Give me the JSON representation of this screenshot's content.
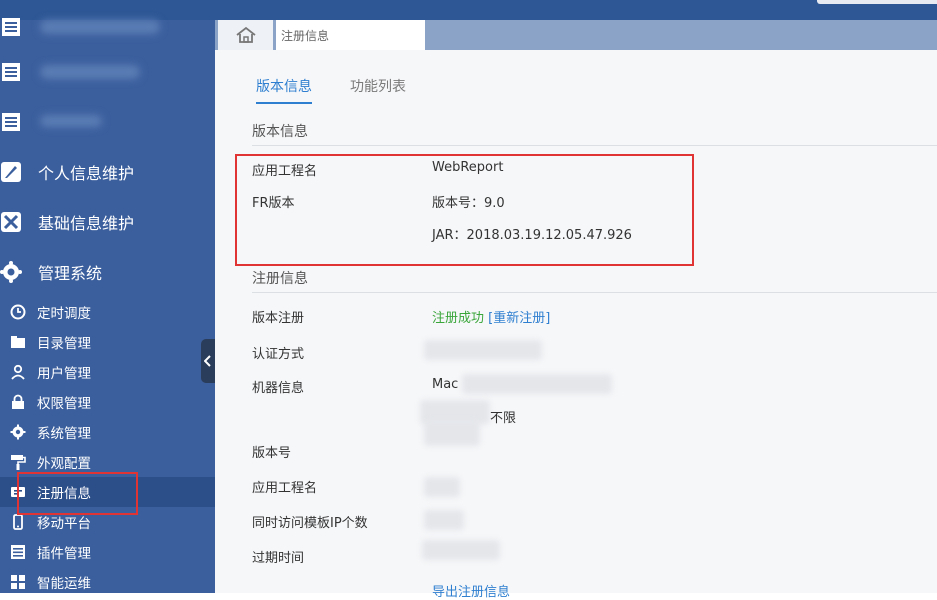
{
  "sidebar": {
    "main_items": [
      {
        "label": "个人信息维护",
        "icon": "feather-icon"
      },
      {
        "label": "基础信息维护",
        "icon": "tools-icon"
      },
      {
        "label": "管理系统",
        "icon": "gear-icon"
      }
    ],
    "sub_items": [
      {
        "label": "定时调度",
        "icon": "clock-icon"
      },
      {
        "label": "目录管理",
        "icon": "folder-icon"
      },
      {
        "label": "用户管理",
        "icon": "user-icon"
      },
      {
        "label": "权限管理",
        "icon": "lock-icon"
      },
      {
        "label": "系统管理",
        "icon": "gear-icon"
      },
      {
        "label": "外观配置",
        "icon": "paint-roller-icon"
      },
      {
        "label": "注册信息",
        "icon": "register-icon"
      },
      {
        "label": "移动平台",
        "icon": "mobile-icon"
      },
      {
        "label": "插件管理",
        "icon": "plugin-icon"
      },
      {
        "label": "智能运维",
        "icon": "grid-icon"
      }
    ],
    "active_sub": "注册信息"
  },
  "tabstrip": {
    "open_tab": "注册信息"
  },
  "content": {
    "tabs": [
      "版本信息",
      "功能列表"
    ],
    "version_section": {
      "title": "版本信息",
      "app_name_label": "应用工程名",
      "app_name_value": "WebReport",
      "fr_label": "FR版本",
      "fr_version": "版本号：9.0",
      "jar": "JAR：2018.03.19.12.05.47.926"
    },
    "register_section": {
      "title": "注册信息",
      "version_reg_label": "版本注册",
      "reg_status": "注册成功",
      "re_register": "[重新注册]",
      "auth_label": "认证方式",
      "machine_label": "机器信息",
      "machine_value_partial": "Mac",
      "machine_value_tail": "不限",
      "version_no_label": "版本号",
      "app_name_label": "应用工程名",
      "concurrent_label": "同时访问模板IP个数",
      "expire_label": "过期时间",
      "export_link": "导出注册信息"
    }
  },
  "colors": {
    "sidebar": "#3b5f9d",
    "active": "#2c4e89",
    "accent": "#2f7fd0",
    "success": "#3aa63a",
    "highlight": "#e03434"
  }
}
